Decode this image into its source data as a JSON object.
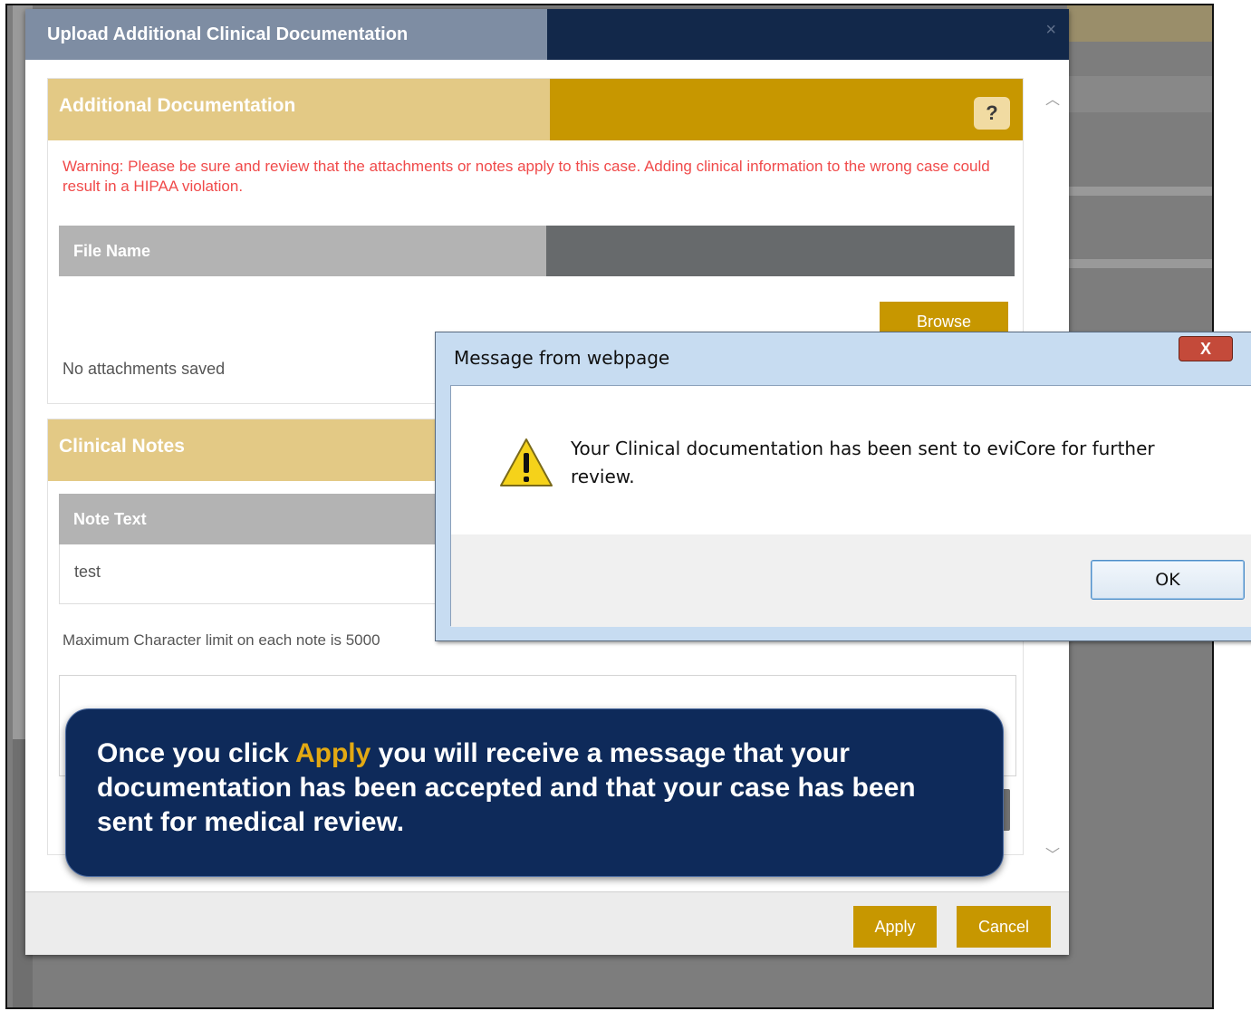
{
  "modal": {
    "title": "Upload Additional Clinical Documentation",
    "close_glyph": "×",
    "scroll_up_glyph": "︿",
    "scroll_down_glyph": "﹀"
  },
  "additional_documentation": {
    "title": "Additional Documentation",
    "help_label": "?",
    "warning": "Warning: Please be sure and review that the attachments or notes apply to this case. Adding clinical information to the wrong case could result in a HIPAA violation.",
    "file_table_header": "File Name",
    "browse_label": "Browse",
    "empty_text": "No  attachments saved"
  },
  "clinical_notes": {
    "title": "Clinical Notes",
    "note_table_header": "Note Text",
    "notes": [
      "test"
    ],
    "limit_text": "Maximum Character limit on each note is 5000"
  },
  "footer": {
    "apply_label": "Apply",
    "cancel_label": "Cancel"
  },
  "dialog": {
    "title": "Message from webpage",
    "close_label": "X",
    "message": "Your Clinical documentation has been sent to eviCore for further review.",
    "ok_label": "OK",
    "icon": "warning-icon"
  },
  "callout": {
    "before": "Once you click ",
    "highlight": "Apply",
    "after": " you will receive a message that your documentation has been accepted and that your case has been sent for medical review."
  },
  "colors": {
    "header_navy": "#12284a",
    "gold": "#c79700",
    "gold_light": "#e3c985",
    "warning_red": "#f04a4a",
    "callout_bg": "#0e2a5a",
    "callout_highlight": "#e3a913"
  }
}
